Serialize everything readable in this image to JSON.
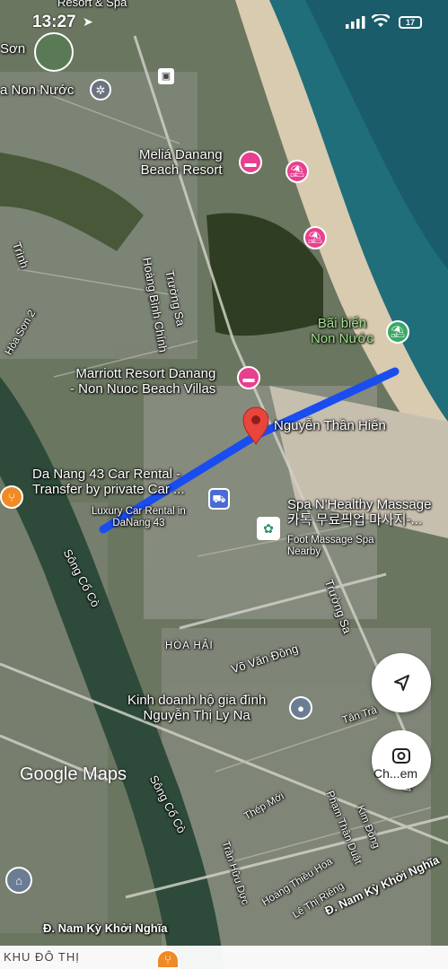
{
  "status_bar": {
    "time": "13:27",
    "battery": "17"
  },
  "map_labels": {
    "top_resort": "Resort & Spa",
    "son": "Sơn",
    "non_nuoc": "a Non Nước",
    "meliа": "Meliá Danang\nBeach Resort",
    "truong_sa_1": "Trường Sa",
    "hoang_binh_chinh": "Hoàng Bình Chính",
    "bai_bien": "Bãi biển\nNon Nước",
    "marriott": "Marriott Resort Danang\n- Non Nuoc Beach Villas",
    "destination": "Nguyễn Thần Hiến",
    "car_rental": "Da Nang 43 Car Rental -\nTransfer by private Car ...",
    "luxury": "Luxury Car Rental in\nDaNang 43",
    "spa": "Spa N'Healthy Massage\n카톡 무료픽업 마사지-...",
    "foot_massage": "Foot Massage Spa\nNearby",
    "song_co_co_1": "Sông Cổ Cò",
    "truong_sa_2": "Trường Sa",
    "hoa_hai": "HÒA HẢI",
    "vo_van_dong": "Võ Văn Đồng",
    "kinh_doanh": "Kinh doanh hộ gia đình\nNguyễn Thị Ly Na",
    "tan_tra": "Tân Trà",
    "song_co_co_2": "Sông Cổ Cò",
    "thep_moi": "Thép Mới",
    "pham_than_duat": "Phạm Thận Duật",
    "kim_dong": "Kim Đồng",
    "tran_huu_duc": "Trần Hữu Dực",
    "hoang_thieu_hoa": "Hoàng Thiều Hoa",
    "le_thi_rieng": "Lê Thị Riêng",
    "nam_ky_right": "Đ. Nam Kỳ Khởi Nghĩa",
    "nam_ky_left": "Đ. Nam Kỳ Khởi Nghĩa",
    "khu_do_thi": "KHU ĐÔ THỊ",
    "vinh": "Trình",
    "hoa_son": "Hòa Sơn 2",
    "van_hai": "Văn Hải"
  },
  "branding": {
    "google_maps": "Google Maps"
  },
  "fabs": {
    "lens_label": "Ch...em"
  },
  "colors": {
    "route": "#1a4df0",
    "pin": "#e8453c",
    "beach": "#d8cbb0",
    "sea": "#1f6e7a"
  }
}
